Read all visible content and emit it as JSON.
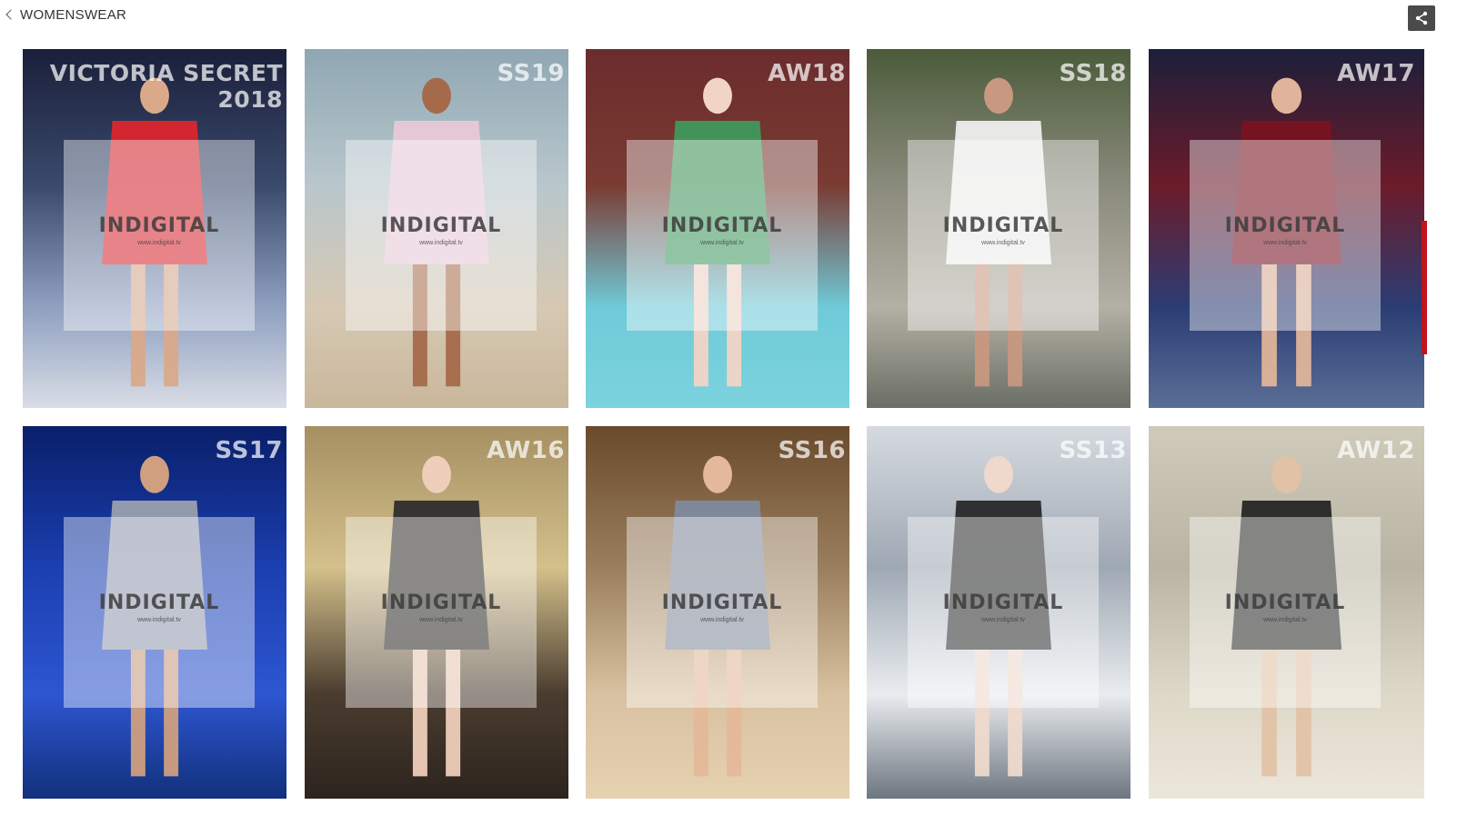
{
  "header": {
    "back_label": "WOMENSWEAR"
  },
  "watermark": {
    "brand": "INDIGITAL",
    "url": "www.indigital.tv"
  },
  "items": [
    {
      "season": "VICTORIA SECRET 2018",
      "colors": [
        "#1a1f3a",
        "#3a4a6c",
        "#8fa0c0",
        "#d9dde6"
      ],
      "accent": "#e1262c",
      "skin": "#d9a98a"
    },
    {
      "season": "SS19",
      "colors": [
        "#8fa7b3",
        "#b9c7cc",
        "#d6c8b3",
        "#c9b79b"
      ],
      "accent": "#e9c9d8",
      "skin": "#a46a4a"
    },
    {
      "season": "AW18",
      "colors": [
        "#6b2c2c",
        "#7a3b33",
        "#6fcad8",
        "#7bd3de"
      ],
      "accent": "#3e9b5e",
      "skin": "#f1d4c6"
    },
    {
      "season": "SS18",
      "colors": [
        "#4b5b3a",
        "#8a8b7c",
        "#b3b0a5",
        "#6a6e64"
      ],
      "accent": "#f2f2f2",
      "skin": "#c99880"
    },
    {
      "season": "AW17",
      "colors": [
        "#1c1f3a",
        "#6c1b2a",
        "#2b3d74",
        "#5a6f96"
      ],
      "accent": "#7a1222",
      "skin": "#e0b49a"
    },
    {
      "season": "SS17",
      "colors": [
        "#0a1f6a",
        "#1b3fb0",
        "#2d56d1",
        "#12307c"
      ],
      "accent": "#9ea3b0",
      "skin": "#cf9f80"
    },
    {
      "season": "AW16",
      "colors": [
        "#a68f62",
        "#d3c08b",
        "#4a3c2f",
        "#2d241e"
      ],
      "accent": "#2a2a2a",
      "skin": "#efcdbb"
    },
    {
      "season": "SS16",
      "colors": [
        "#6a4a2c",
        "#9a7f5e",
        "#d8c1a0",
        "#e6d1b0"
      ],
      "accent": "#7f8ba0",
      "skin": "#e4b89a"
    },
    {
      "season": "SS13",
      "colors": [
        "#d6dae0",
        "#9ea8b3",
        "#e9ecef",
        "#6d7680"
      ],
      "accent": "#242424",
      "skin": "#eed9cc"
    },
    {
      "season": "AW12",
      "colors": [
        "#cfcab9",
        "#b9b4a3",
        "#ded8c8",
        "#ece7db"
      ],
      "accent": "#222222",
      "skin": "#e1c2a6"
    }
  ]
}
